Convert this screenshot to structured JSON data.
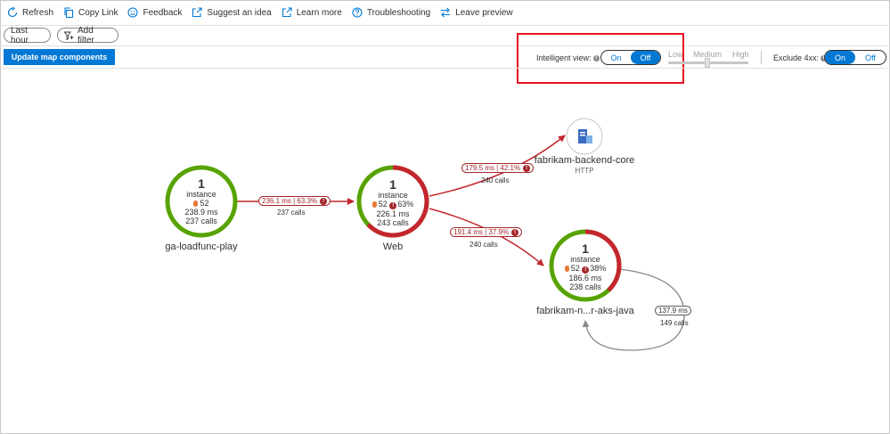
{
  "toolbar": {
    "items": [
      {
        "label": "Refresh",
        "icon": "refresh-icon"
      },
      {
        "label": "Copy Link",
        "icon": "copy-icon"
      },
      {
        "label": "Feedback",
        "icon": "smiley-icon"
      },
      {
        "label": "Suggest an idea",
        "icon": "external-link-icon"
      },
      {
        "label": "Learn more",
        "icon": "external-link-icon"
      },
      {
        "label": "Troubleshooting",
        "icon": "help-icon"
      },
      {
        "label": "Leave preview",
        "icon": "swap-icon"
      }
    ]
  },
  "filters": {
    "time_range": "Last hour",
    "add_filter": "Add filter"
  },
  "update_button": "Update map components",
  "intelligent_view": {
    "label": "Intelligent view:",
    "on": "On",
    "off": "Off",
    "selected": "Off",
    "levels": [
      "Low",
      "Medium",
      "High"
    ]
  },
  "exclude_4xx": {
    "label": "Exclude 4xx:",
    "on": "On",
    "off": "Off",
    "selected": "On"
  },
  "colors": {
    "accent": "#0078d4",
    "healthy": "#57a300",
    "failing": "#c4262e",
    "highlight": "#e81123"
  },
  "nodes": {
    "ga": {
      "count": "1",
      "unit": "instance",
      "alerts": "52",
      "duration": "238.9 ms",
      "calls": "237 calls",
      "name": "ga-loadfunc-play",
      "failure_fraction": 0
    },
    "web": {
      "count": "1",
      "unit": "instance",
      "alerts": "52",
      "failure": "63%",
      "duration": "226.1 ms",
      "calls": "243 calls",
      "name": "Web",
      "failure_fraction": 0.63
    },
    "backend": {
      "name": "fabrikam-backend-core",
      "type": "HTTP",
      "icon": "server-icon"
    },
    "java": {
      "count": "1",
      "unit": "instance",
      "alerts": "52",
      "failure": "38%",
      "duration": "186.6 ms",
      "calls": "238 calls",
      "name": "fabrikam-n...r-aks-java",
      "failure_fraction": 0.38
    }
  },
  "edges": {
    "ga_web": {
      "badge": "236.1 ms | 63.3%",
      "calls": "237 calls"
    },
    "web_backend": {
      "badge": "179.5 ms | 42.1%",
      "calls": "240 calls"
    },
    "web_java": {
      "badge": "191.4 ms | 37.9%",
      "calls": "240 calls"
    },
    "java_self": {
      "badge": "137.9 ms",
      "calls": "149 calls"
    }
  }
}
